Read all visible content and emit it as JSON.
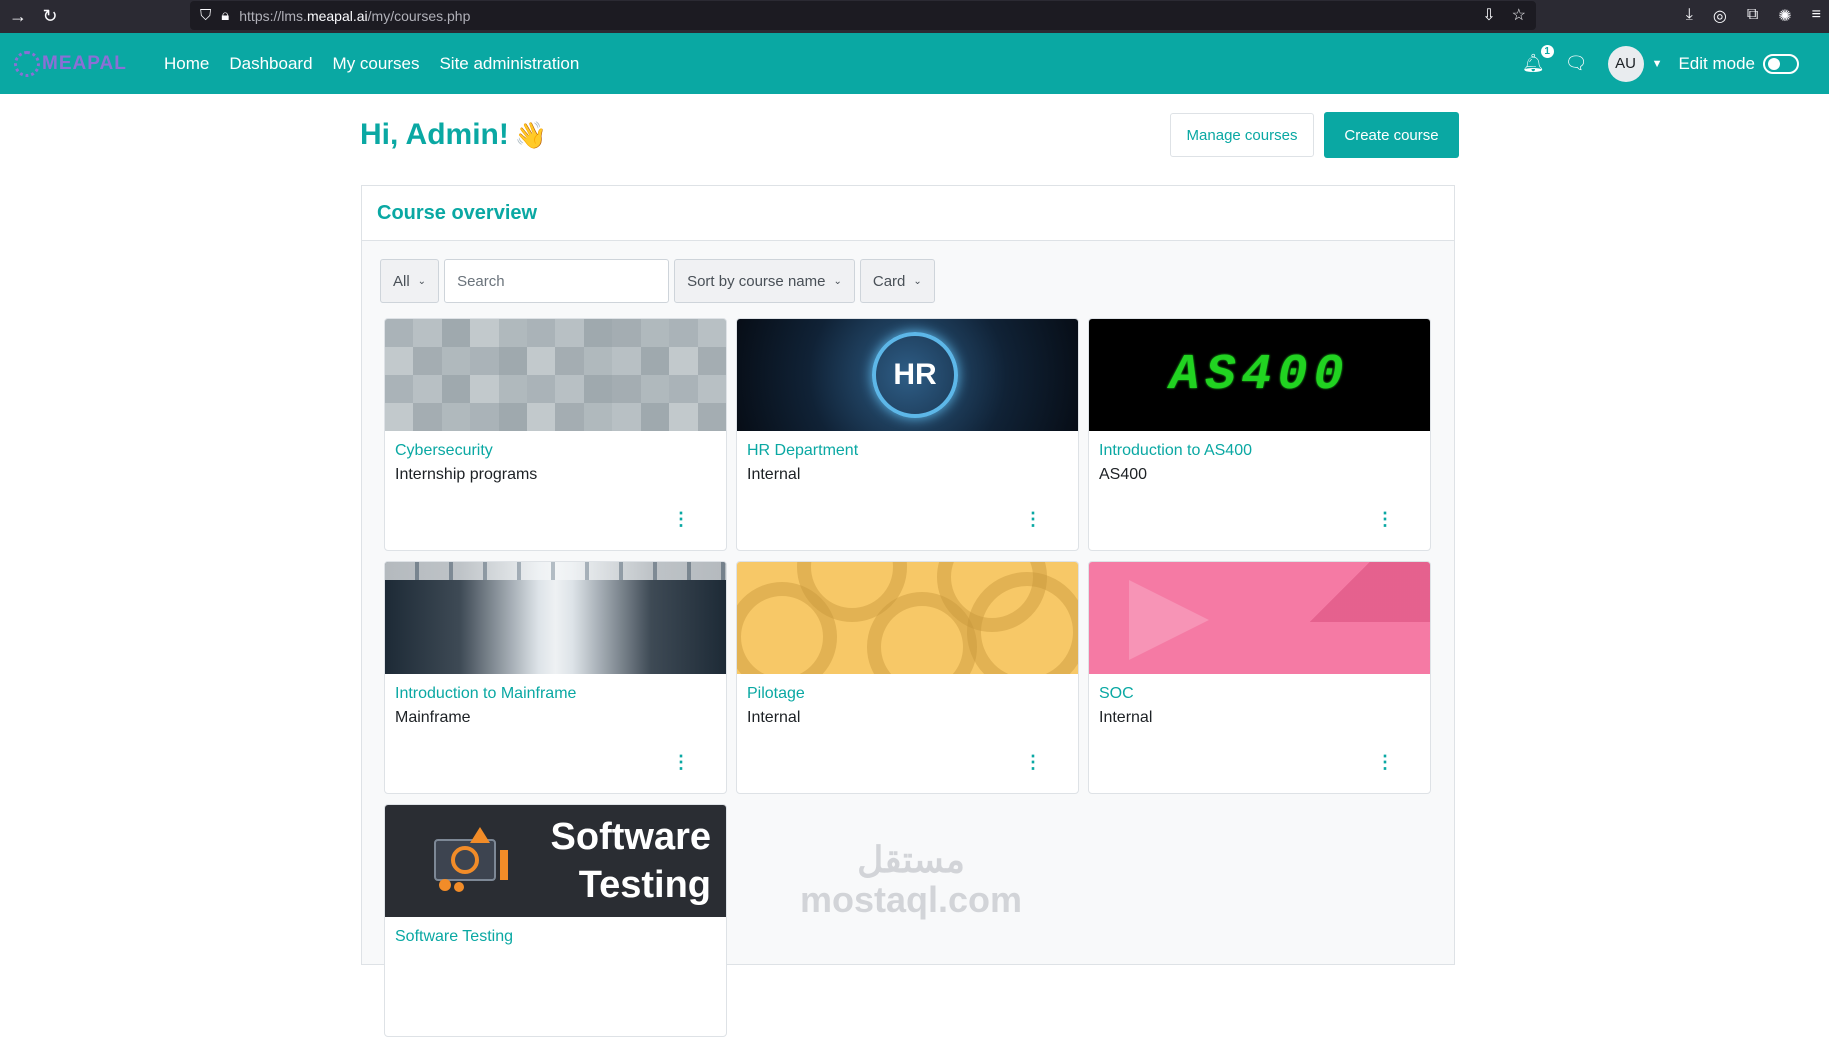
{
  "browser": {
    "url_prefix": "https://lms.",
    "url_domain": "meapal.ai",
    "url_path": "/my/courses.php"
  },
  "navbar": {
    "logo_text": "MEAPAL",
    "links": [
      "Home",
      "Dashboard",
      "My courses",
      "Site administration"
    ],
    "notification_count": "1",
    "avatar_initials": "AU",
    "edit_mode_label": "Edit mode"
  },
  "header": {
    "greeting": "Hi, Admin!",
    "wave": "👋",
    "manage_courses": "Manage courses",
    "create_course": "Create course"
  },
  "course_overview": {
    "title": "Course overview",
    "filter": "All",
    "search_placeholder": "Search",
    "sort": "Sort by course name",
    "view": "Card",
    "courses": [
      {
        "name": "Cybersecurity",
        "category": "Internship programs"
      },
      {
        "name": "HR Department",
        "category": "Internal",
        "image_text": "HR"
      },
      {
        "name": "Introduction to AS400",
        "category": "AS400",
        "image_text": "AS400"
      },
      {
        "name": "Introduction to Mainframe",
        "category": "Mainframe"
      },
      {
        "name": "Pilotage",
        "category": "Internal"
      },
      {
        "name": "SOC",
        "category": "Internal"
      },
      {
        "name": "Software Testing",
        "category": "",
        "image_text_1": "Software",
        "image_text_2": "Testing"
      }
    ]
  },
  "watermark": {
    "arabic": "مستقل",
    "latin": "mostaql.com"
  },
  "colors": {
    "brand": "#0aa8a3",
    "browser_bg": "#2b2a33"
  }
}
